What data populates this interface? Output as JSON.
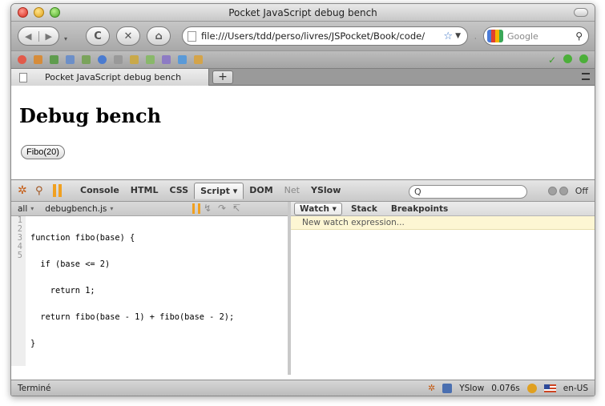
{
  "window": {
    "title": "Pocket JavaScript debug bench"
  },
  "navbar": {
    "back_glyph": "◀",
    "forward_glyph": "▶",
    "reload_glyph": "C",
    "stop_glyph": "✕",
    "home_glyph": "⌂",
    "url": "file:///Users/tdd/perso/livres/JSPocket/Book/code/",
    "bookmark_glyph": "☆",
    "dropdown_glyph": "▼",
    "search_engine_placeholder": "Google",
    "search_glyph": "⚲"
  },
  "toolsbar": {
    "check_glyph": "✓"
  },
  "tabs": {
    "active_label": "Pocket JavaScript debug bench",
    "new_tab_label": "+"
  },
  "page": {
    "heading": "Debug bench",
    "button_label": "Fibo(20)"
  },
  "firebug": {
    "tabs": [
      "Console",
      "HTML",
      "CSS",
      "Script ▾",
      "DOM",
      "Net",
      "YSlow"
    ],
    "active_tab": "Script",
    "search_glyph": "Q",
    "off_label": "Off",
    "script_filter": "all",
    "script_file": "debugbench.js",
    "caret": "▾",
    "code_lines": [
      "function fibo(base) {",
      "  if (base <= 2)",
      "    return 1;",
      "  return fibo(base - 1) + fibo(base - 2);",
      "}"
    ],
    "line_numbers": [
      "1",
      "2",
      "3",
      "4",
      "5"
    ],
    "watch_tabs": [
      "Watch ▾",
      "Stack",
      "Breakpoints"
    ],
    "watch_placeholder": "New watch expression..."
  },
  "statusbar": {
    "left_text": "Terminé",
    "yslow_label": "YSlow",
    "timing": "0.076s",
    "locale": "en-US"
  }
}
